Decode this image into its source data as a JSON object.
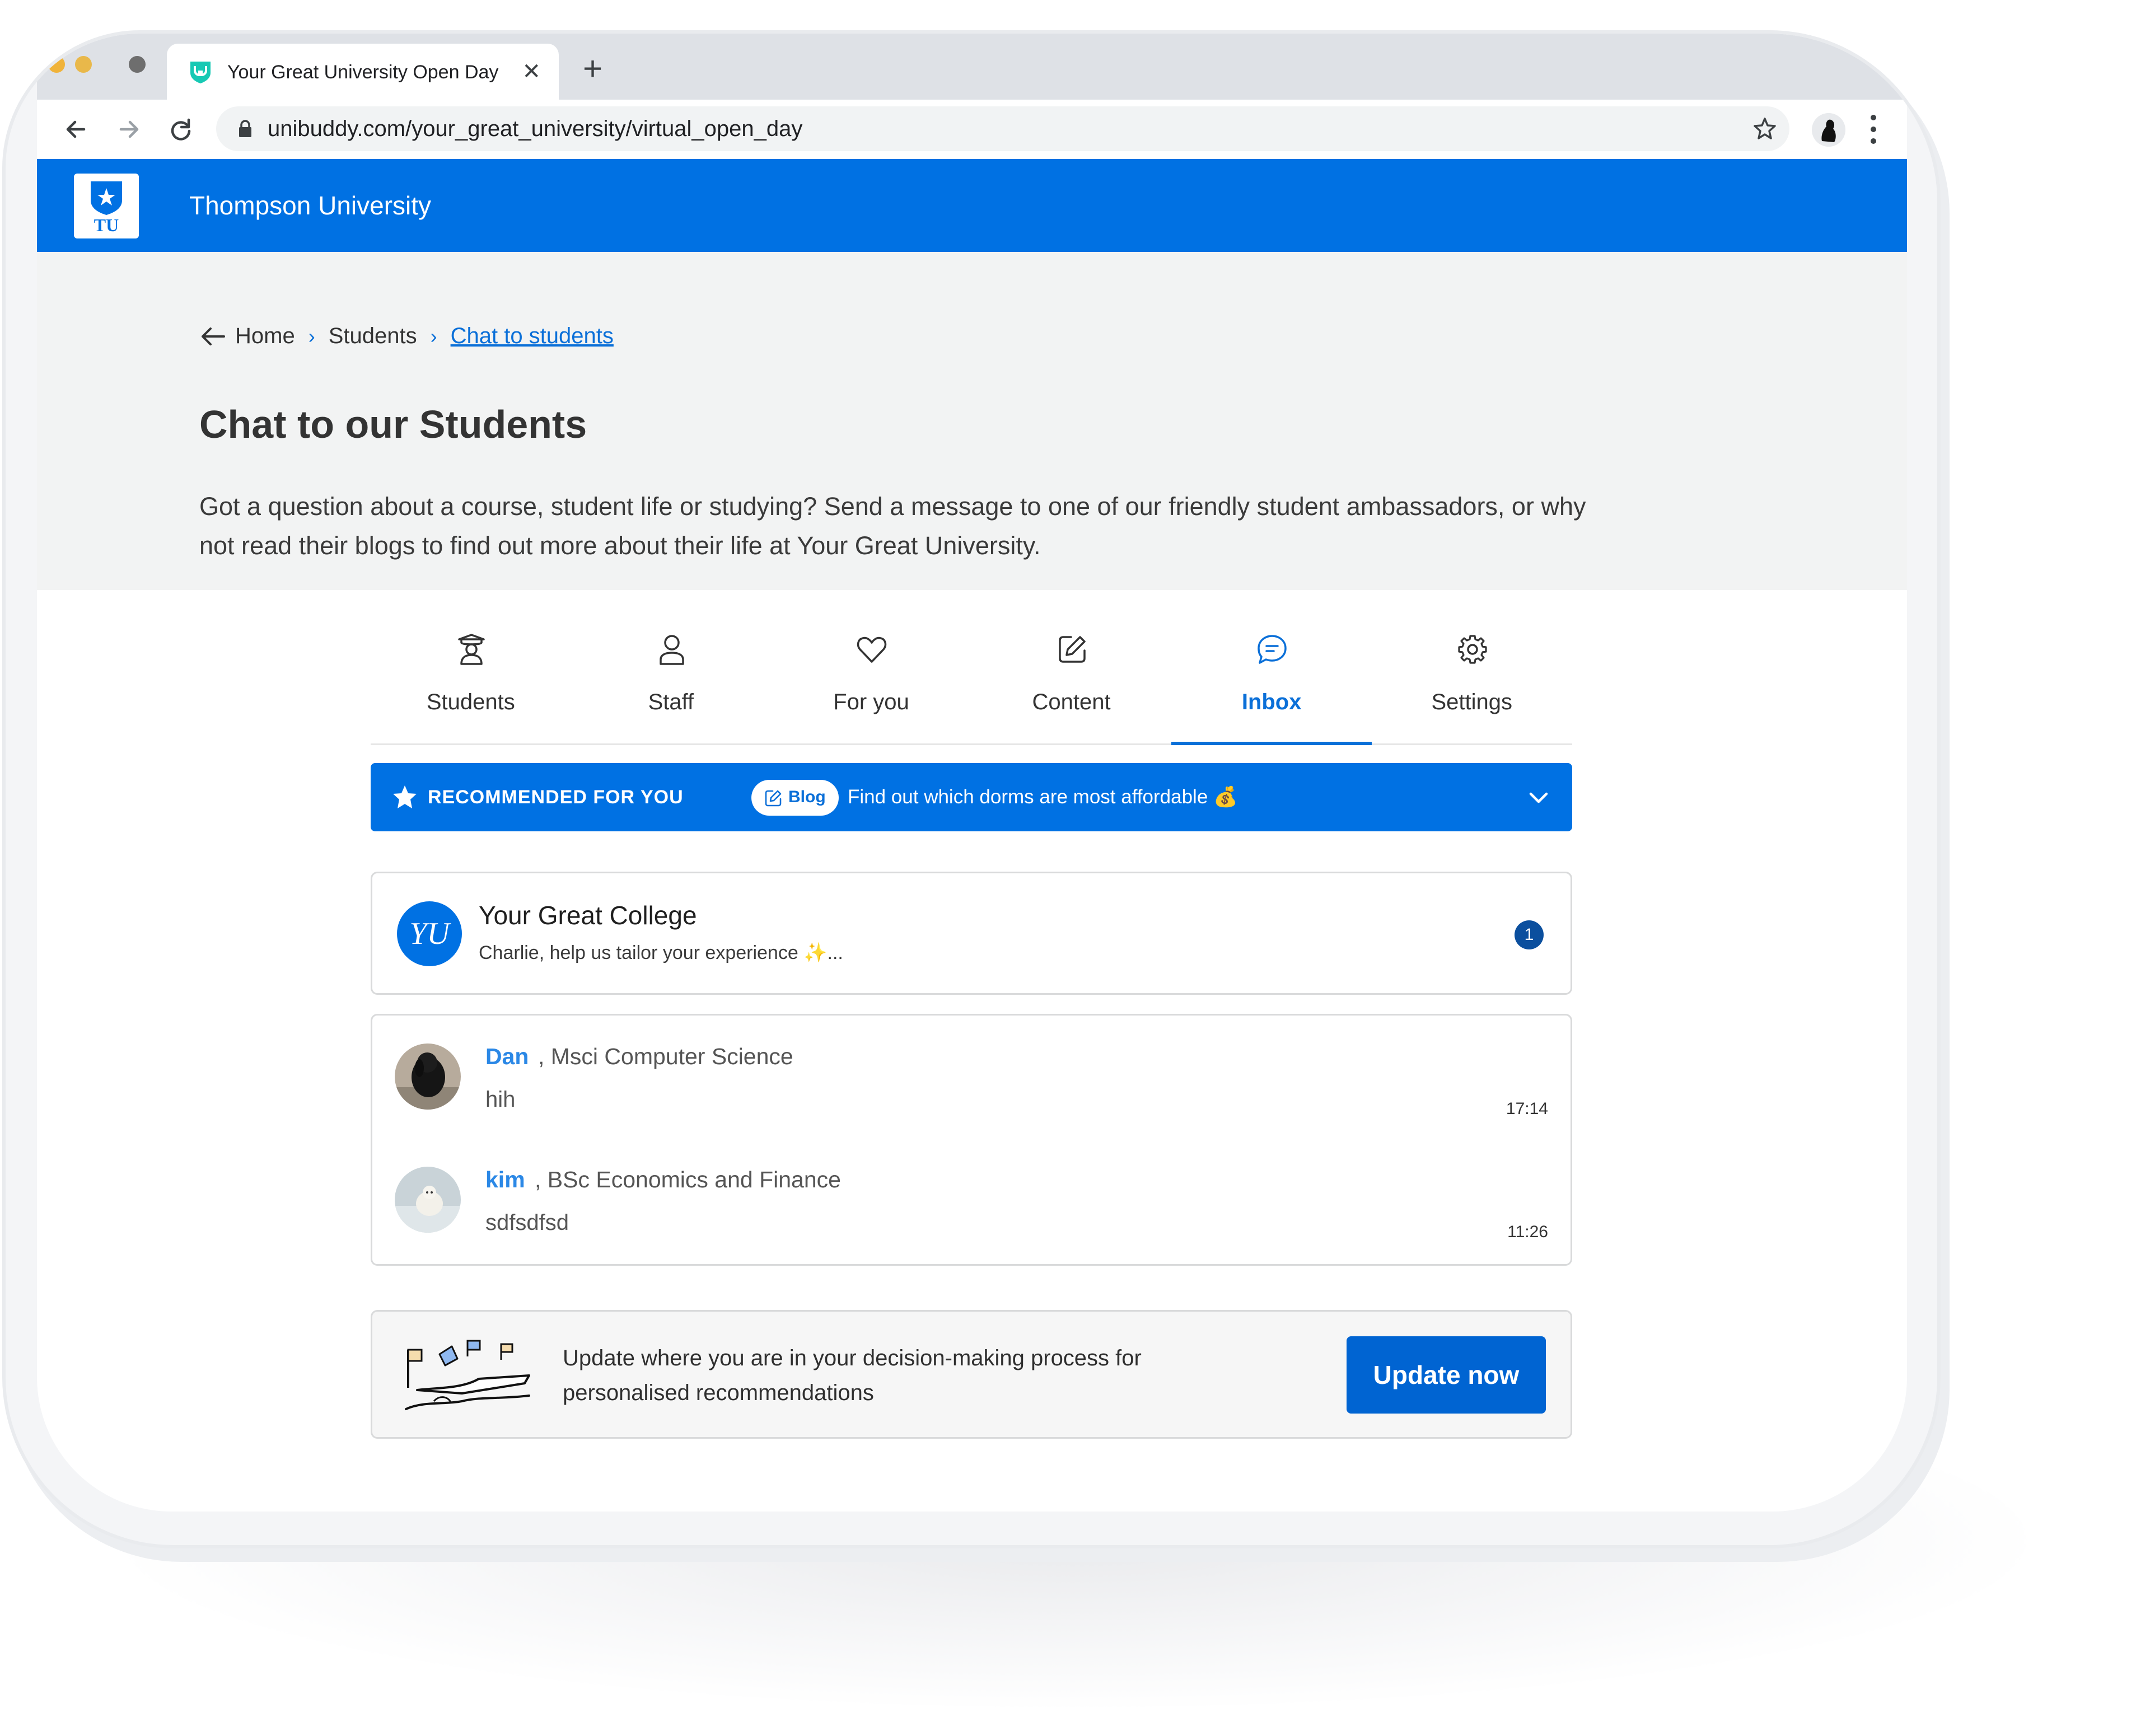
{
  "browser": {
    "tab_title": "Your Great University Open Day",
    "tab_close": "✕",
    "new_tab": "+",
    "url": "unibuddy.com/your_great_university/virtual_open_day"
  },
  "site": {
    "logo_text": "TU",
    "name": "Thompson University"
  },
  "breadcrumb": {
    "home": "Home",
    "students": "Students",
    "current": "Chat to students",
    "separator": "›"
  },
  "hero": {
    "title": "Chat to our Students",
    "description": "Got a question about a course, student life or studying? Send a message to one of our friendly student ambassadors, or why not read their blogs to find out more about their life at Your Great University."
  },
  "tabs": [
    {
      "label": "Students",
      "icon": "graduate-icon"
    },
    {
      "label": "Staff",
      "icon": "person-icon"
    },
    {
      "label": "For you",
      "icon": "heart-icon"
    },
    {
      "label": "Content",
      "icon": "edit-icon"
    },
    {
      "label": "Inbox",
      "icon": "chat-icon",
      "active": true
    },
    {
      "label": "Settings",
      "icon": "gear-icon"
    }
  ],
  "recommended": {
    "label": "RECOMMENDED FOR YOU",
    "pill": "Blog",
    "text": "Find out which dorms are most affordable 💰"
  },
  "college": {
    "avatar": "YU",
    "name": "Your Great College",
    "message": "Charlie, help us tailor your experience ✨...",
    "unread": "1"
  },
  "chats": [
    {
      "name": "Dan",
      "course": ", Msci Computer Science",
      "message": "hih",
      "time": "17:14"
    },
    {
      "name": "kim",
      "course": ", BSc Economics and Finance",
      "message": "sdfsdfsd",
      "time": "11:26"
    }
  ],
  "update": {
    "text": "Update where you are in your decision-making process for personalised recommendations",
    "button": "Update now"
  },
  "colors": {
    "brand_blue": "#0071e3",
    "link_blue": "#0a6fd8",
    "badge_navy": "#0b4f9e"
  }
}
